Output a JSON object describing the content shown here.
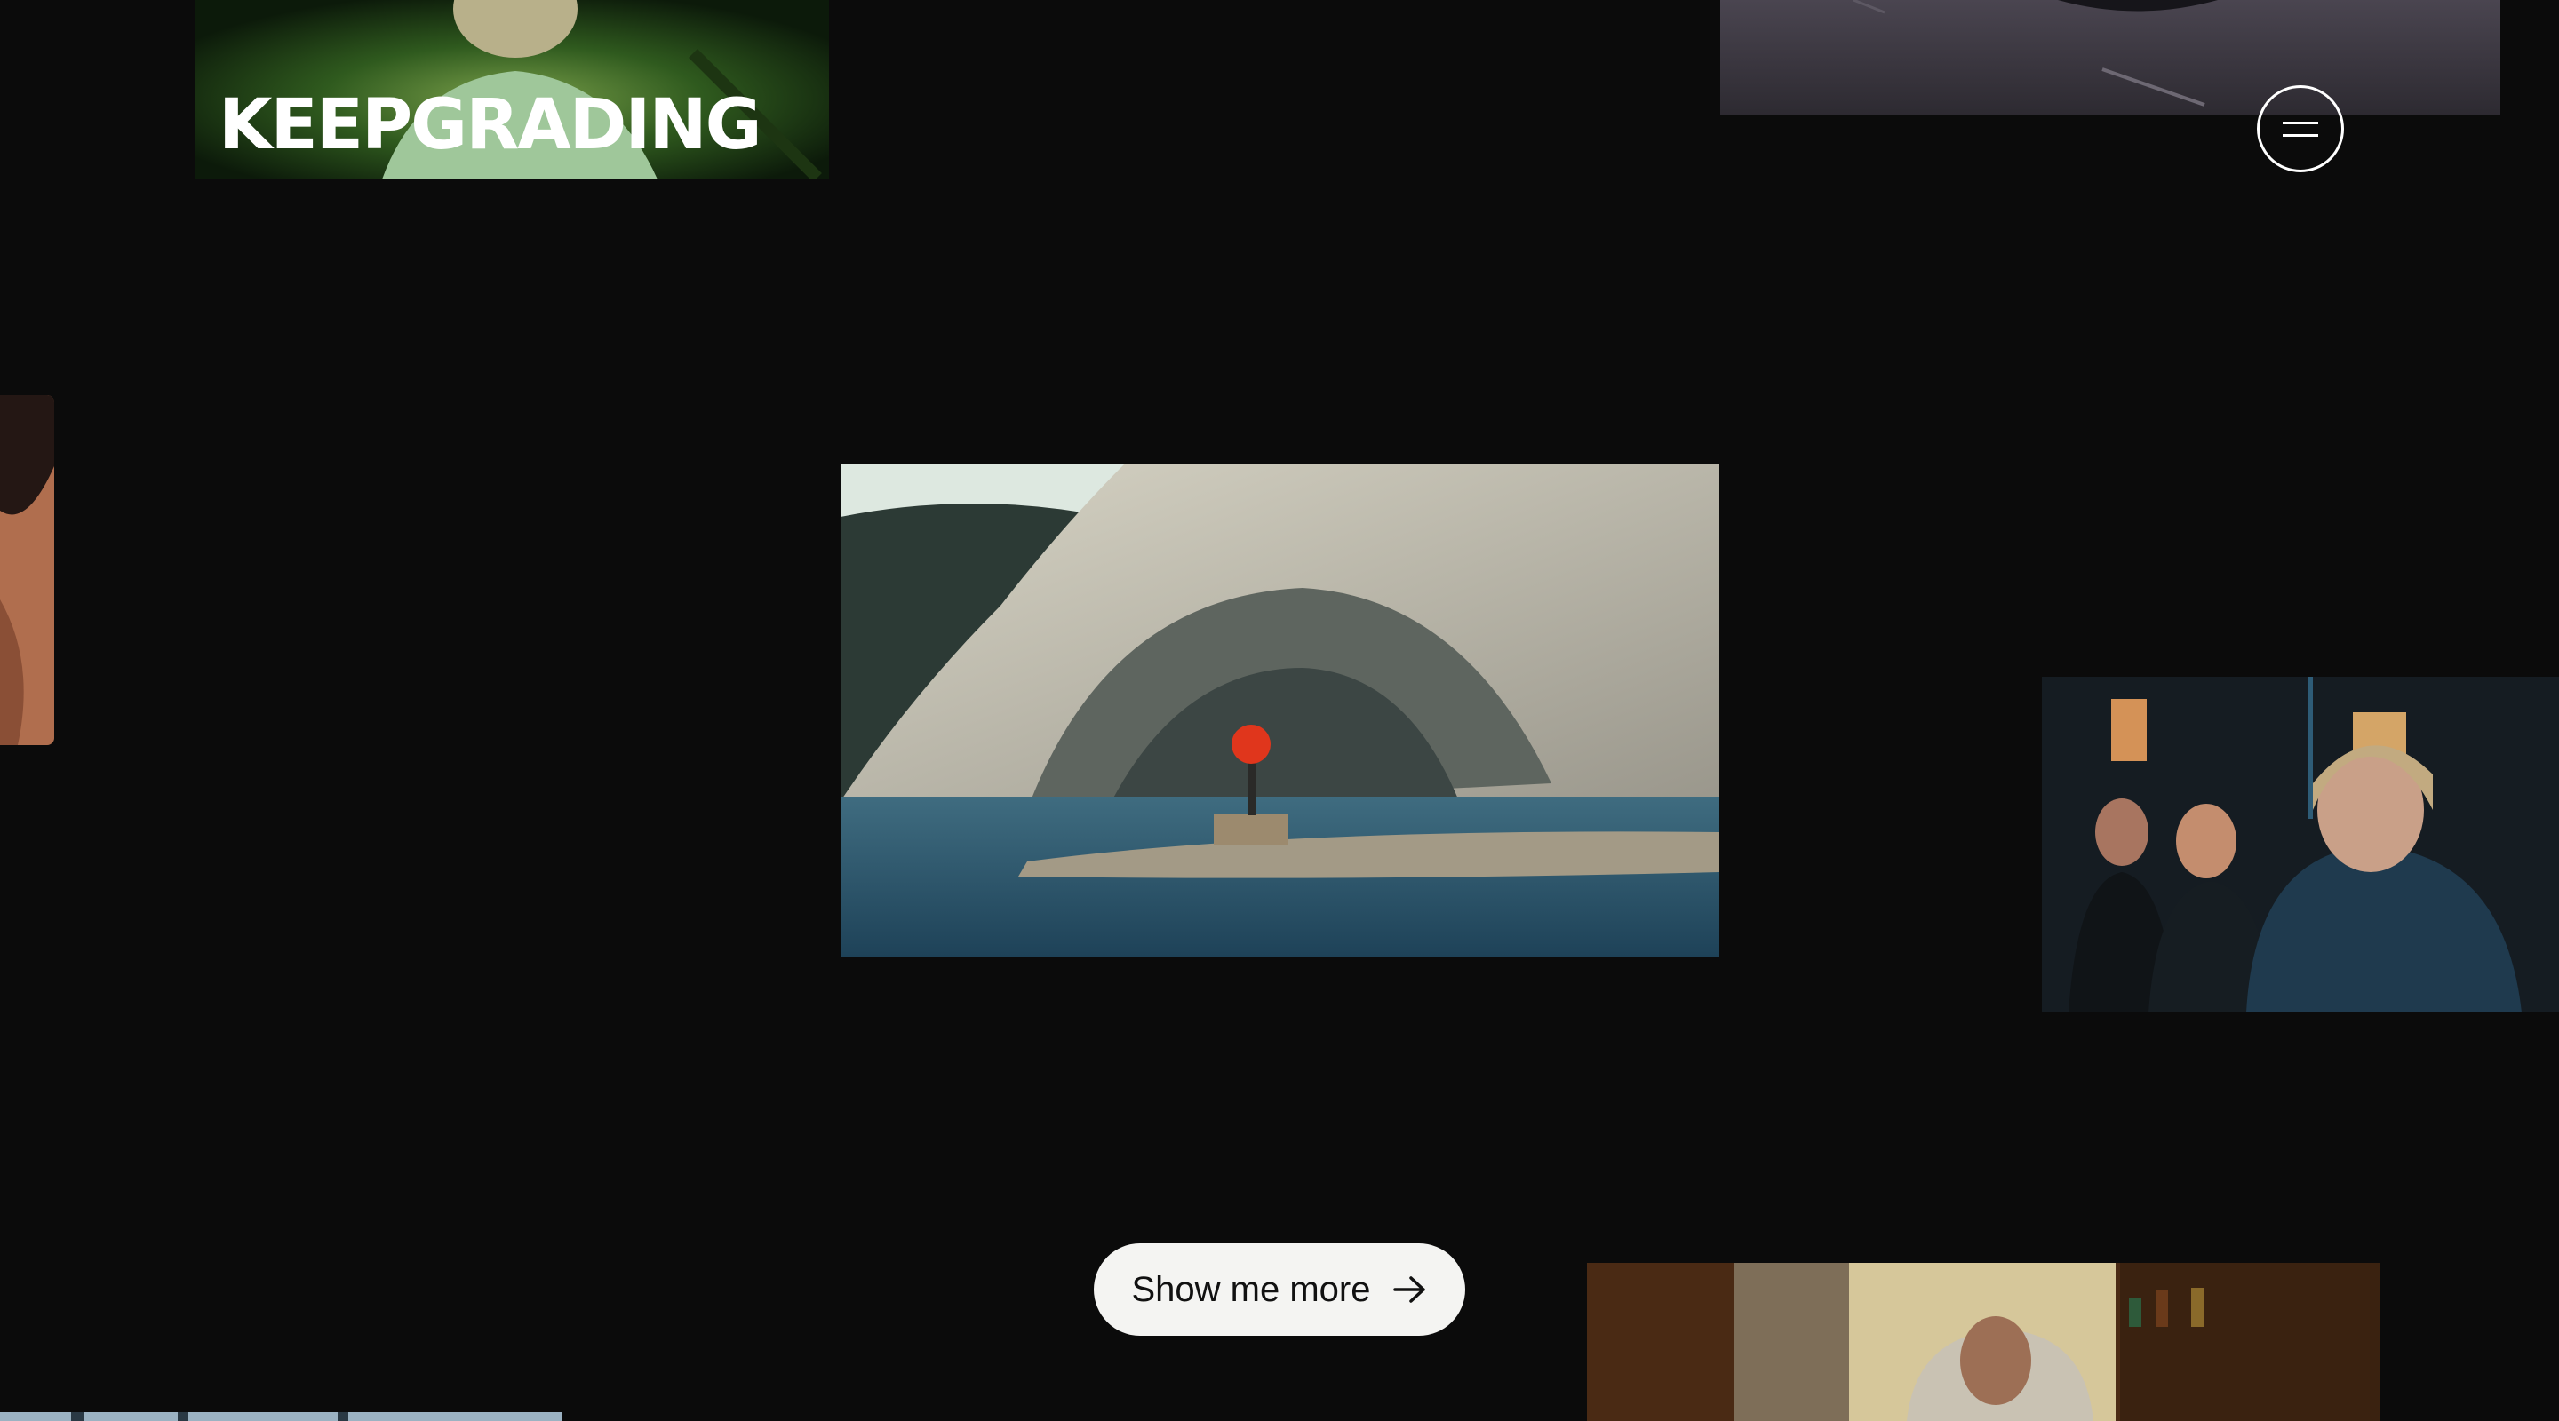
{
  "brand": {
    "logo_text": "KEEPGRADING"
  },
  "header": {
    "menu_icon": "hamburger-icon"
  },
  "cta": {
    "label": "Show me more",
    "icon": "arrow-right-icon"
  },
  "colors": {
    "background": "#0b0b0b",
    "cta_background": "#f4f4f2",
    "foreground": "#ffffff"
  }
}
